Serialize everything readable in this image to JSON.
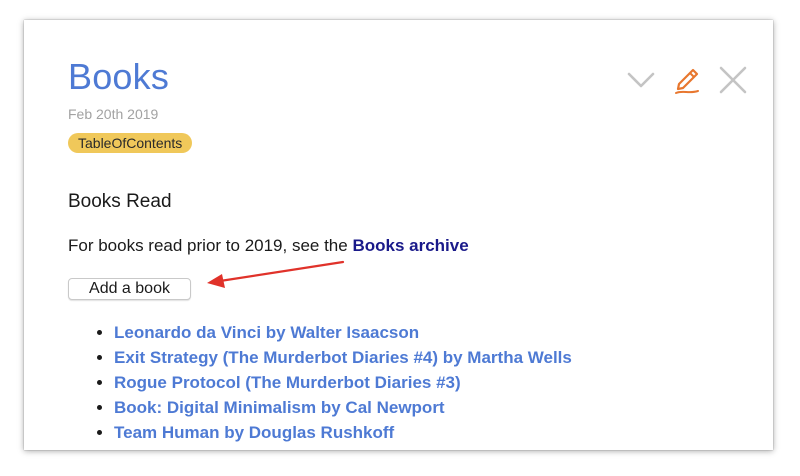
{
  "note": {
    "title": "Books",
    "date": "Feb 20th 2019",
    "tag": "TableOfContents"
  },
  "toolbar": {
    "icons": [
      "chevron-down-icon",
      "pencil-icon",
      "close-icon"
    ],
    "colors": {
      "chevron": "#c4c4c4",
      "pencil": "#e8772e",
      "close": "#c4c4c4"
    }
  },
  "content": {
    "heading": "Books Read",
    "intro_text": "For books read prior to 2019, see the ",
    "intro_link": "Books archive",
    "add_button_label": "Add a book",
    "books": [
      "Leonardo da Vinci by Walter Isaacson",
      "Exit Strategy (The Murderbot Diaries #4) by Martha Wells",
      "Rogue Protocol (The Murderbot Diaries #3)",
      "Book: Digital Minimalism by Cal Newport",
      "Team Human by Douglas Rushkoff"
    ]
  },
  "colors": {
    "title": "#4e7ad4",
    "link": "#4e7ad4",
    "archive_link": "#1a1a8a",
    "tag_bg": "#f0c85a",
    "annotation_arrow": "#e0322a"
  }
}
